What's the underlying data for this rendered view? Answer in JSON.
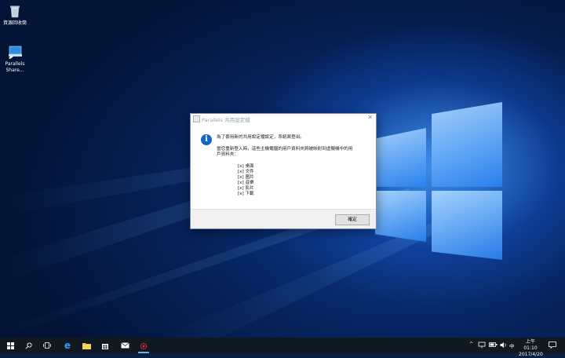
{
  "desktop": {
    "icons": [
      {
        "label": "資源回收筒",
        "icon": "recycle-bin-icon"
      },
      {
        "label": "Parallels Share...",
        "icon": "parallels-share-icon"
      }
    ]
  },
  "dialog": {
    "title": "Parallels 共用設定檔",
    "message_line1": "為了套用新的共用設定檔設定，系統將登出。",
    "message_line2a": "當您重新登入時，這些主機電腦的用戶資料夾將被映射到虛擬機中的用",
    "message_line2b": "戶資料夾：",
    "folders": [
      "[x] 桌面",
      "[x] 文件",
      "[x] 圖片",
      "[x] 音樂",
      "[x] 影片",
      "[x] 下載"
    ],
    "ok_label": "確定"
  },
  "taskbar": {
    "clock_time": "上午 01:10",
    "clock_date": "2017/4/20",
    "ime": "中"
  },
  "colors": {
    "accent": "#1366c7",
    "taskbar": "#101820",
    "desktop": "#06235c"
  }
}
